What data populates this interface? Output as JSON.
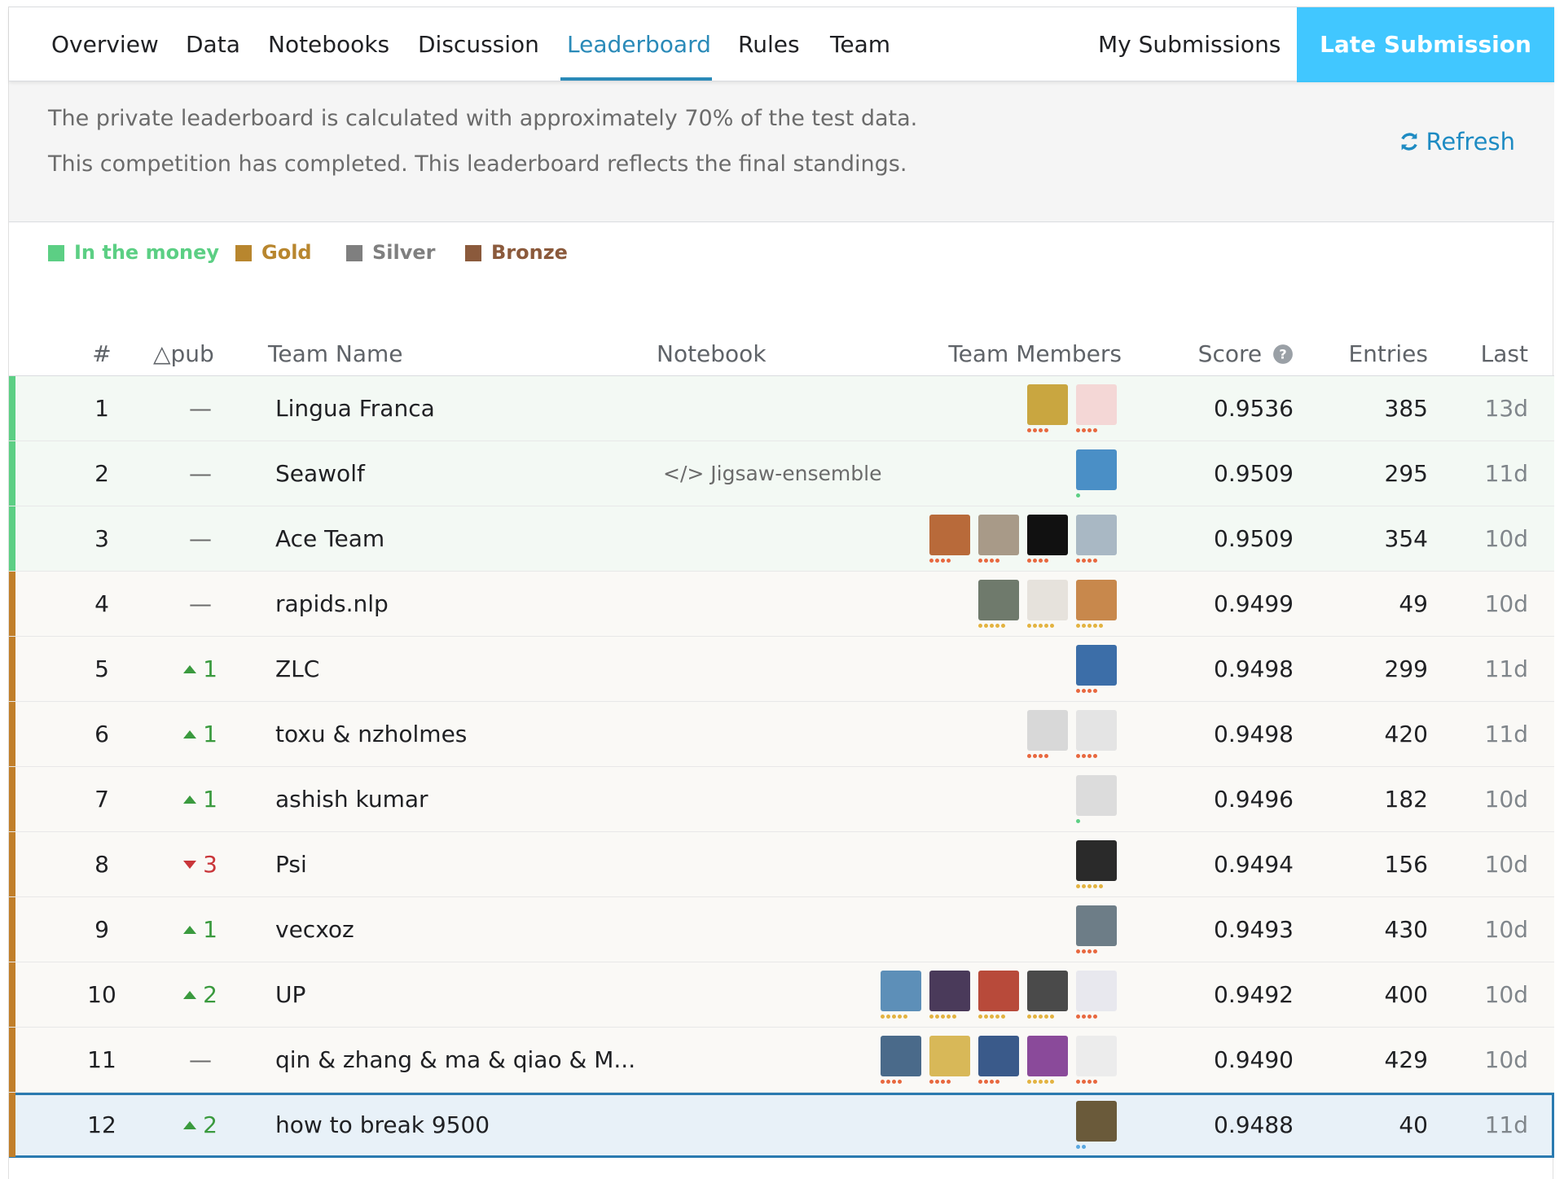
{
  "nav": {
    "tabs": [
      {
        "label": "Overview",
        "active": false
      },
      {
        "label": "Data",
        "active": false
      },
      {
        "label": "Notebooks",
        "active": false
      },
      {
        "label": "Discussion",
        "active": false
      },
      {
        "label": "Leaderboard",
        "active": true
      },
      {
        "label": "Rules",
        "active": false
      },
      {
        "label": "Team",
        "active": false
      }
    ],
    "my_submissions": "My Submissions",
    "late_submission": "Late Submission"
  },
  "info": {
    "line1": "The private leaderboard is calculated with approximately 70% of the test data.",
    "line2": "This competition has completed. This leaderboard reflects the final standings.",
    "refresh": "Refresh"
  },
  "legend": [
    {
      "label": "In the money",
      "color": "#5ccf84"
    },
    {
      "label": "Gold",
      "color": "#b8862e"
    },
    {
      "label": "Silver",
      "color": "#7f7f7f"
    },
    {
      "label": "Bronze",
      "color": "#8b5a3c"
    }
  ],
  "columns": {
    "rank": "#",
    "delta": "△pub",
    "team": "Team Name",
    "notebook": "Notebook",
    "members": "Team Members",
    "score": "Score",
    "entries": "Entries",
    "last": "Last"
  },
  "colors": {
    "money_bar": "#5ccf84",
    "gold_bar": "#c17f2a",
    "money_bg": "#f3f9f4",
    "gold_bg": "#faf9f6",
    "accent": "#2a8ab8"
  },
  "rows": [
    {
      "rank": "1",
      "delta": "—",
      "dir": "none",
      "team": "Lingua Franca",
      "notebook": "",
      "score": "0.9536",
      "entries": "385",
      "last": "13d",
      "tier": "money",
      "members": [
        {
          "c": "#c9a640",
          "dots": 4,
          "dc": "#e8683f"
        },
        {
          "c": "#f4d7d6",
          "dots": 4,
          "dc": "#e8683f"
        }
      ]
    },
    {
      "rank": "2",
      "delta": "—",
      "dir": "none",
      "team": "Seawolf",
      "notebook": "</> Jigsaw-ensemble",
      "score": "0.9509",
      "entries": "295",
      "last": "11d",
      "tier": "money",
      "members": [
        {
          "c": "#4a8fc6",
          "dots": 1,
          "dc": "#5ccf84"
        }
      ]
    },
    {
      "rank": "3",
      "delta": "—",
      "dir": "none",
      "team": "Ace Team",
      "notebook": "",
      "score": "0.9509",
      "entries": "354",
      "last": "10d",
      "tier": "money",
      "members": [
        {
          "c": "#b86a3a",
          "dots": 4,
          "dc": "#e8683f"
        },
        {
          "c": "#a89a88",
          "dots": 4,
          "dc": "#e8683f"
        },
        {
          "c": "#111111",
          "dots": 4,
          "dc": "#e8683f"
        },
        {
          "c": "#a9b8c4",
          "dots": 4,
          "dc": "#e8683f"
        }
      ]
    },
    {
      "rank": "4",
      "delta": "—",
      "dir": "none",
      "team": "rapids.nlp",
      "notebook": "",
      "score": "0.9499",
      "entries": "49",
      "last": "10d",
      "tier": "gold",
      "members": [
        {
          "c": "#6f7a6c",
          "dots": 5,
          "dc": "#e3b341"
        },
        {
          "c": "#e6e2dc",
          "dots": 5,
          "dc": "#e3b341"
        },
        {
          "c": "#c8884c",
          "dots": 5,
          "dc": "#e3b341"
        }
      ]
    },
    {
      "rank": "5",
      "delta": "1",
      "dir": "up",
      "team": "ZLC",
      "notebook": "",
      "score": "0.9498",
      "entries": "299",
      "last": "11d",
      "tier": "gold",
      "members": [
        {
          "c": "#3c6ea8",
          "dots": 4,
          "dc": "#e8683f"
        }
      ]
    },
    {
      "rank": "6",
      "delta": "1",
      "dir": "up",
      "team": "toxu & nzholmes",
      "notebook": "",
      "score": "0.9498",
      "entries": "420",
      "last": "11d",
      "tier": "gold",
      "members": [
        {
          "c": "#d8d8d8",
          "dots": 4,
          "dc": "#e8683f"
        },
        {
          "c": "#e4e4e4",
          "dots": 4,
          "dc": "#e8683f"
        }
      ]
    },
    {
      "rank": "7",
      "delta": "1",
      "dir": "up",
      "team": "ashish kumar",
      "notebook": "",
      "score": "0.9496",
      "entries": "182",
      "last": "10d",
      "tier": "gold",
      "members": [
        {
          "c": "#dcdcdc",
          "dots": 1,
          "dc": "#5ccf84"
        }
      ]
    },
    {
      "rank": "8",
      "delta": "3",
      "dir": "down",
      "team": "Psi",
      "notebook": "",
      "score": "0.9494",
      "entries": "156",
      "last": "10d",
      "tier": "gold",
      "members": [
        {
          "c": "#2a2a2a",
          "dots": 5,
          "dc": "#e3b341"
        }
      ]
    },
    {
      "rank": "9",
      "delta": "1",
      "dir": "up",
      "team": "vecxoz",
      "notebook": "",
      "score": "0.9493",
      "entries": "430",
      "last": "10d",
      "tier": "gold",
      "members": [
        {
          "c": "#6d7d87",
          "dots": 4,
          "dc": "#e8683f"
        }
      ]
    },
    {
      "rank": "10",
      "delta": "2",
      "dir": "up",
      "team": "UP",
      "notebook": "",
      "score": "0.9492",
      "entries": "400",
      "last": "10d",
      "tier": "gold",
      "members": [
        {
          "c": "#5d8fb8",
          "dots": 5,
          "dc": "#e3b341"
        },
        {
          "c": "#4a3a5a",
          "dots": 5,
          "dc": "#e3b341"
        },
        {
          "c": "#b84a3a",
          "dots": 5,
          "dc": "#e3b341"
        },
        {
          "c": "#4a4a4a",
          "dots": 5,
          "dc": "#e3b341"
        },
        {
          "c": "#e8e8ee",
          "dots": 4,
          "dc": "#e8683f"
        }
      ]
    },
    {
      "rank": "11",
      "delta": "—",
      "dir": "none",
      "team": "qin & zhang & ma & qiao & M...",
      "notebook": "",
      "score": "0.9490",
      "entries": "429",
      "last": "10d",
      "tier": "gold",
      "members": [
        {
          "c": "#4a6a8a",
          "dots": 4,
          "dc": "#e8683f"
        },
        {
          "c": "#d8b858",
          "dots": 4,
          "dc": "#e8683f"
        },
        {
          "c": "#3a5a8a",
          "dots": 4,
          "dc": "#e8683f"
        },
        {
          "c": "#8a4a9a",
          "dots": 5,
          "dc": "#e3b341"
        },
        {
          "c": "#ececec",
          "dots": 4,
          "dc": "#e8683f"
        }
      ]
    },
    {
      "rank": "12",
      "delta": "2",
      "dir": "up",
      "team": "how to break 9500",
      "notebook": "",
      "score": "0.9488",
      "entries": "40",
      "last": "11d",
      "tier": "gold",
      "selected": true,
      "members": [
        {
          "c": "#6a5a3a",
          "dots": 2,
          "dc": "#5aa8e0"
        }
      ]
    }
  ]
}
